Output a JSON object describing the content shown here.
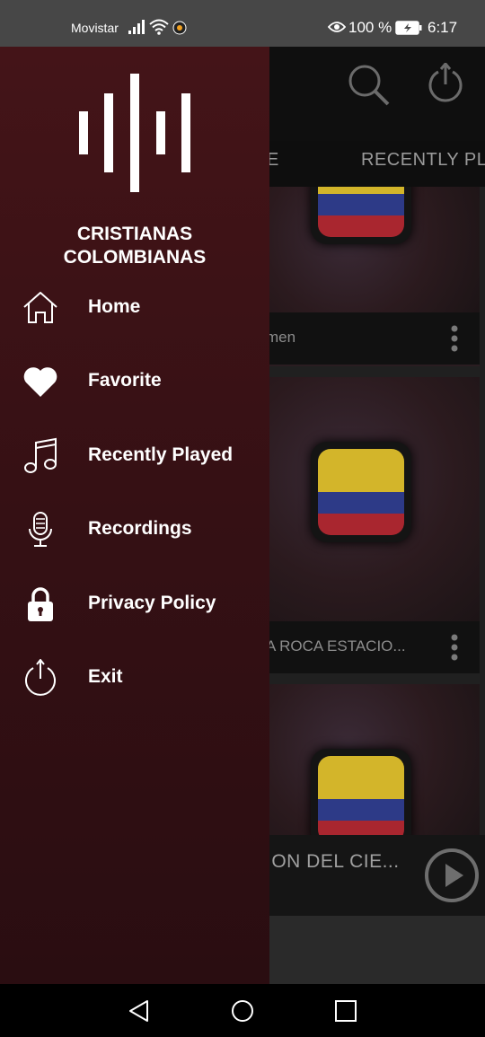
{
  "status_bar": {
    "carrier": "Movistar",
    "battery_percent": "100 %",
    "time": "6:17",
    "icons": [
      "signal-icon",
      "wifi-icon",
      "notification-app-icon",
      "eye-icon",
      "battery-charging-icon"
    ]
  },
  "background": {
    "tabs": [
      "E",
      "RECENTLY PL"
    ],
    "cards": [
      {
        "title": "men"
      },
      {
        "title": "A ROCA ESTACIO..."
      },
      {
        "title": ""
      }
    ],
    "mini_player": {
      "title": "ION DEL CIE..."
    },
    "icons": [
      "search-icon",
      "power-icon",
      "more-vert-icon",
      "play-icon"
    ]
  },
  "drawer": {
    "app_name_line1": "CRISTIANAS",
    "app_name_line2": "COLOMBIANAS",
    "menu": [
      {
        "label": "Home",
        "icon": "home-icon"
      },
      {
        "label": "Favorite",
        "icon": "heart-icon"
      },
      {
        "label": "Recently Played",
        "icon": "music-note-icon"
      },
      {
        "label": "Recordings",
        "icon": "microphone-icon"
      },
      {
        "label": "Privacy Policy",
        "icon": "lock-icon"
      },
      {
        "label": "Exit",
        "icon": "power-icon"
      }
    ]
  },
  "colors": {
    "drawer_top": "#441418",
    "drawer_bottom": "#2a0d11",
    "flag_yellow": "#d3b52a",
    "flag_blue": "#2d3a87",
    "flag_red": "#a9262f"
  }
}
